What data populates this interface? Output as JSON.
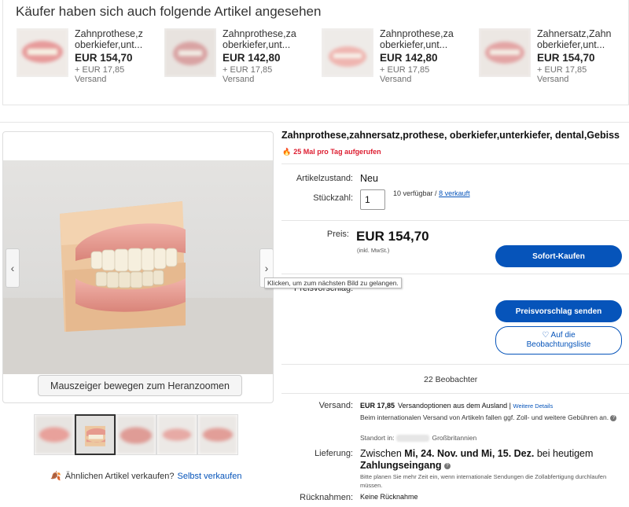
{
  "also_viewed": {
    "heading": "Käufer haben sich auch folgende Artikel angesehen",
    "items": [
      {
        "title_line1": "Zahnprothese,z",
        "title_line2": "oberkiefer,unt...",
        "price": "EUR 154,70",
        "shipping_line1": "+ EUR 17,85",
        "shipping_line2": "Versand"
      },
      {
        "title_line1": "Zahnprothese,za",
        "title_line2": "oberkiefer,unt...",
        "price": "EUR 142,80",
        "shipping_line1": "+ EUR 17,85",
        "shipping_line2": "Versand"
      },
      {
        "title_line1": "Zahnprothese,za",
        "title_line2": "oberkiefer,unt...",
        "price": "EUR 142,80",
        "shipping_line1": "+ EUR 17,85",
        "shipping_line2": "Versand"
      },
      {
        "title_line1": "Zahnersatz,Zahn",
        "title_line2": "oberkiefer,unt...",
        "price": "EUR 154,70",
        "shipping_line1": "+ EUR 17,85",
        "shipping_line2": "Versand"
      }
    ]
  },
  "gallery": {
    "prev_icon": "‹",
    "next_icon": "›",
    "zoom_hint": "Mauszeiger bewegen zum Heranzoomen",
    "tooltip": "Klicken, um zum nächsten Bild zu gelangen.",
    "thumbnail_count": 5,
    "selected_thumbnail": 2
  },
  "sell_similar": {
    "text": "Ähnlichen Artikel verkaufen?",
    "link": "Selbst verkaufen"
  },
  "item": {
    "title": "Zahnprothese,zahnersatz,prothese, oberkiefer,unterkiefer, dental,Gebiss",
    "views": "25 Mal pro Tag aufgerufen",
    "condition_label": "Artikelzustand:",
    "condition": "Neu",
    "quantity_label": "Stückzahl:",
    "quantity": "1",
    "available": "10 verfügbar /",
    "sold": "8 verkauft",
    "price_label": "Preis:",
    "price": "EUR 154,70",
    "vat_note": "(inkl. MwSt.)",
    "buy_now": "Sofort-Kaufen",
    "offer_label": "Preisvorschlag:",
    "make_offer": "Preisvorschlag senden",
    "watch_line1": "Auf die",
    "watch_line2": "Beobachtungsliste",
    "watchers": "22 Beobachter"
  },
  "shipping": {
    "label": "Versand:",
    "price": "EUR 17,85",
    "desc": "Versandoptionen aus dem Ausland |",
    "details_link": "Weitere Details",
    "note": "Beim internationalen Versand von Artikeln fallen ggf. Zoll- und weitere Gebühren an.",
    "location_label": "Standort in:",
    "location_country": "Großbritannien"
  },
  "delivery": {
    "label": "Lieferung:",
    "text_prefix": "Zwischen",
    "date_range": "Mi, 24. Nov. und Mi, 15. Dez.",
    "text_mid": "bei heutigem",
    "text_end": "Zahlungseingang",
    "note": "Bitte planen Sie mehr Zeit ein, wenn internationale Sendungen die Zollabfertigung durchlaufen müssen."
  },
  "returns": {
    "label": "Rücknahmen:",
    "value": "Keine Rücknahme"
  },
  "colors": {
    "link": "#0654ba",
    "primary_button": "#0654ba",
    "views_red": "#dd1e31",
    "leaf_green": "#86b817"
  }
}
